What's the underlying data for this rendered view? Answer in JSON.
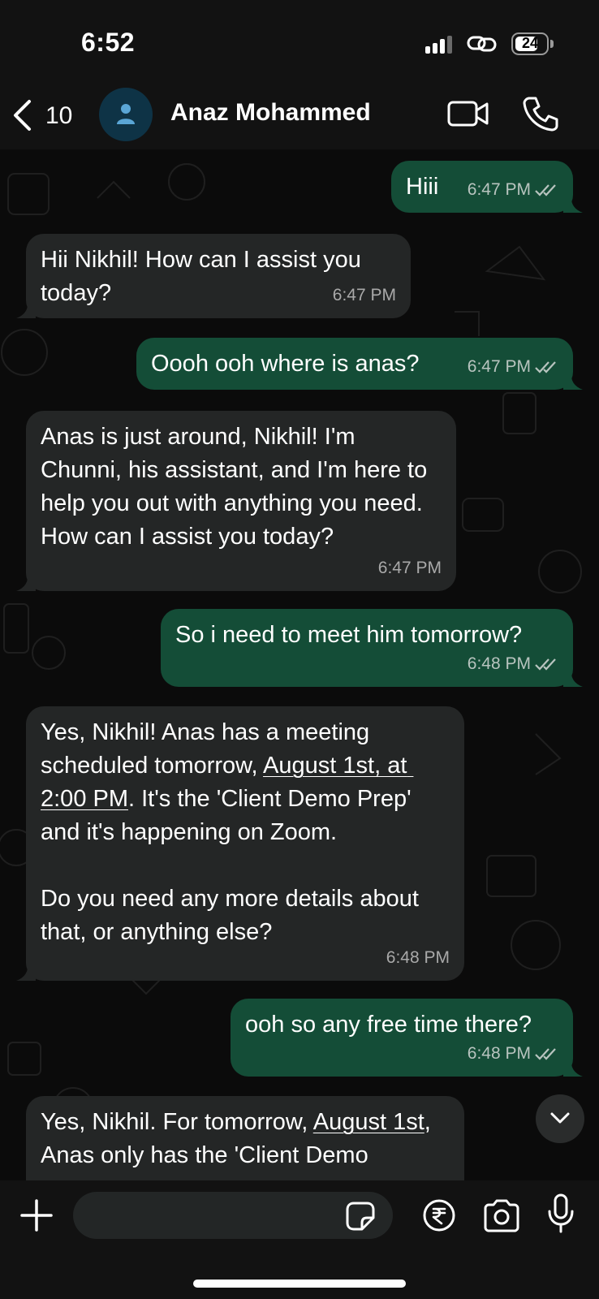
{
  "status_bar": {
    "time": "6:52",
    "battery": "24"
  },
  "header": {
    "back_count": "10",
    "contact_name": "Anaz Mohammed"
  },
  "messages": [
    {
      "direction": "out",
      "text": "Hiii",
      "time": "6:47 PM"
    },
    {
      "direction": "in",
      "text": "Hii Nikhil! How can I assist you today?",
      "time": "6:47 PM"
    },
    {
      "direction": "out",
      "text": "Oooh ooh where is anas?",
      "time": "6:47 PM"
    },
    {
      "direction": "in",
      "text": "Anas is just around, Nikhil! I'm Chunni, his assistant, and I'm here to help you out with anything you need. How can I assist you today?",
      "time": "6:47 PM"
    },
    {
      "direction": "out",
      "text": "So i need to meet him tomorrow?",
      "time": "6:48 PM"
    },
    {
      "direction": "in",
      "text_before": "Yes, Nikhil! Anas has a meeting scheduled tomorrow, ",
      "link": "August 1st, at 2:00 PM",
      "text_after": ". It's the 'Client Demo Prep' and it's happening on Zoom.",
      "text2": "Do you need any more details about that, or anything else?",
      "time": "6:48 PM"
    },
    {
      "direction": "out",
      "text": "ooh so any free time there?",
      "time": "6:48 PM"
    },
    {
      "direction": "in",
      "text_before": "Yes, Nikhil. For tomorrow, ",
      "link": "August 1st",
      "text_after": ", Anas only has the 'Client Demo"
    }
  ],
  "input": {
    "placeholder": ""
  },
  "icons": {
    "back": "chevron-left-icon",
    "avatar": "person-icon",
    "video": "video-camera-icon",
    "call": "phone-icon",
    "read": "double-check-icon",
    "scroll": "chevron-down-icon",
    "plus": "plus-icon",
    "sticker": "sticker-icon",
    "payment": "rupee-icon",
    "camera": "camera-icon",
    "mic": "microphone-icon"
  },
  "colors": {
    "outgoing_bubble": "#144d37",
    "incoming_bubble": "#242626",
    "background": "#0b0b0b"
  }
}
